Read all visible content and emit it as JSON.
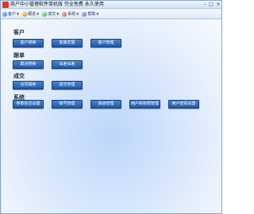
{
  "window": {
    "title": "商户中小管理软件单机版   完全免费 永久使用"
  },
  "toolbar": {
    "items": [
      {
        "label": "客户",
        "icon": "user-icon"
      },
      {
        "label": "跟进",
        "icon": "follow-icon"
      },
      {
        "label": "成交",
        "icon": "deal-icon"
      },
      {
        "label": "系统",
        "icon": "system-icon"
      },
      {
        "label": "帮助",
        "icon": "help-icon"
      }
    ]
  },
  "sections": {
    "customer": {
      "label": "客户",
      "buttons": [
        "客户搜索",
        "客服发展",
        "客户管理"
      ]
    },
    "followup": {
      "label": "跟单",
      "buttons": [
        "跟进搜索",
        "出差出差"
      ]
    },
    "deal": {
      "label": "成交",
      "buttons": [
        "合同模板",
        "成交管理"
      ]
    },
    "system": {
      "label": "系统",
      "buttons": [
        "参数信息设置",
        "账号管理",
        "高级管理",
        "用户和权限管理",
        "用户密码设置"
      ]
    }
  }
}
